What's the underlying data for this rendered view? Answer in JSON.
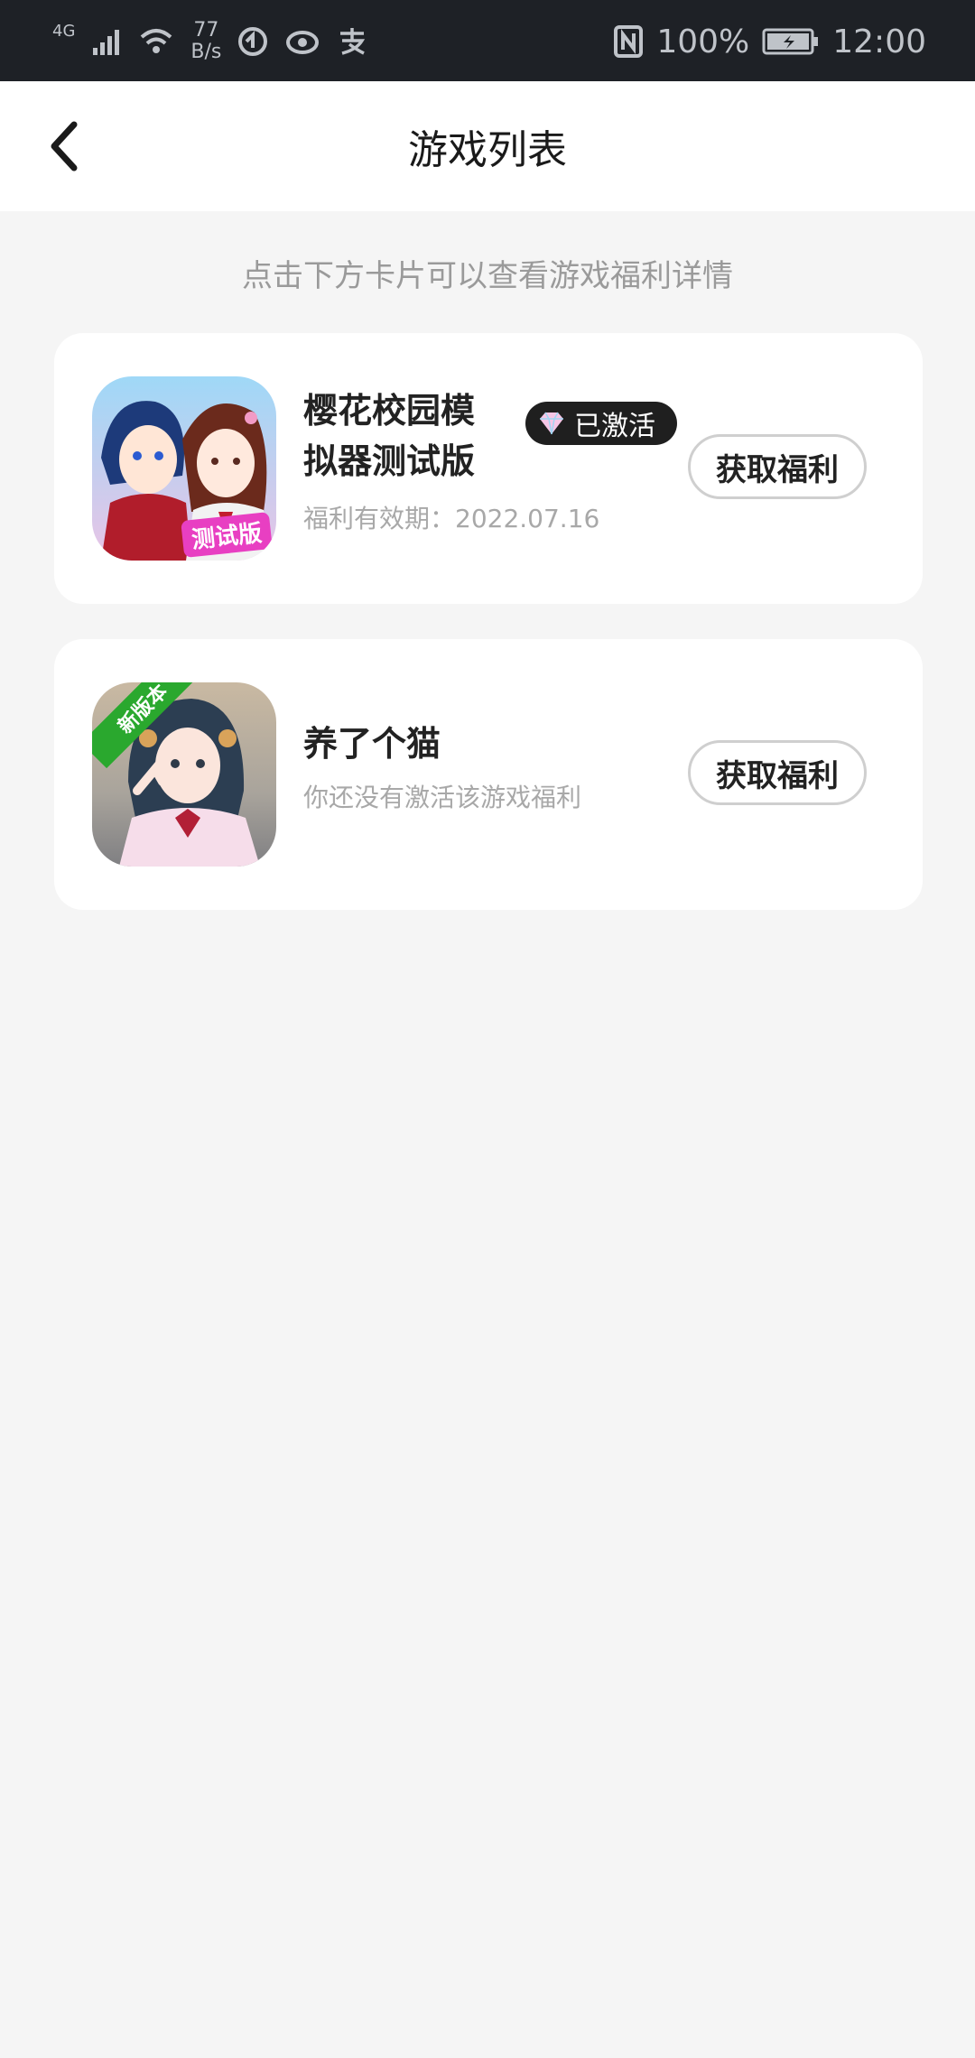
{
  "status_bar": {
    "network": "4G",
    "speed_value": "77",
    "speed_unit": "B/s",
    "battery": "100%",
    "time": "12:00"
  },
  "header": {
    "title": "游戏列表"
  },
  "hint": "点击下方卡片可以查看游戏福利详情",
  "games": [
    {
      "name": "樱花校园模拟器测试版",
      "badge": "已激活",
      "sub": "福利有效期：2022.07.16",
      "button": "获取福利",
      "icon_tag": "测试版"
    },
    {
      "name": "养了个猫",
      "sub": "你还没有激活该游戏福利",
      "button": "获取福利",
      "icon_tag": "新版本"
    }
  ],
  "colors": {
    "status_bg": "#1e2126",
    "page_bg": "#f5f5f5",
    "badge_bg": "#1f1f1f",
    "tag_green": "#2aa82e",
    "tag_pink": "#e83fc2"
  }
}
